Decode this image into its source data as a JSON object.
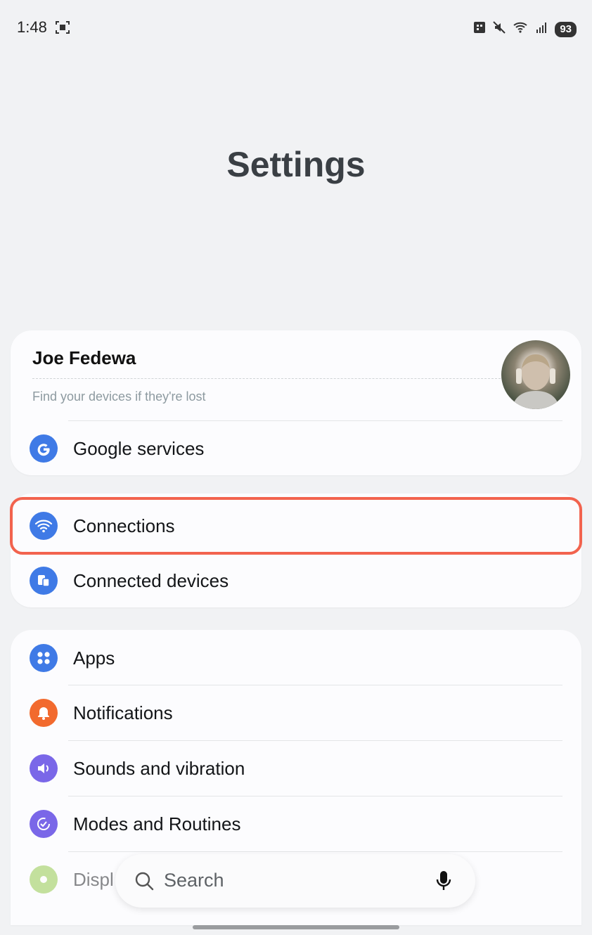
{
  "status_bar": {
    "time": "1:48",
    "battery": "93",
    "icons": [
      "screenshot-icon",
      "work-profile-icon",
      "mute-icon",
      "wifi-6e-icon",
      "signal-icon"
    ]
  },
  "title": "Settings",
  "account": {
    "name": "Joe Fedewa",
    "subtitle": "Find your devices if they're lost",
    "google_services": "Google services"
  },
  "connections_group": {
    "connections": "Connections",
    "connected_devices": "Connected devices"
  },
  "apps_group": {
    "items": [
      {
        "label": "Apps",
        "icon": "apps-icon",
        "color": "#3f7ae6"
      },
      {
        "label": "Notifications",
        "icon": "bell-icon",
        "color": "#f26a2e"
      },
      {
        "label": "Sounds and vibration",
        "icon": "speaker-icon",
        "color": "#7a67e8"
      },
      {
        "label": "Modes and Routines",
        "icon": "routine-icon",
        "color": "#7a67e8"
      },
      {
        "label": "Displ",
        "icon": "display-icon",
        "color": "#8cc63f"
      }
    ]
  },
  "search": {
    "placeholder": "Search"
  },
  "colors": {
    "blue": "#3f7ae6",
    "highlight": "#f2634e"
  }
}
